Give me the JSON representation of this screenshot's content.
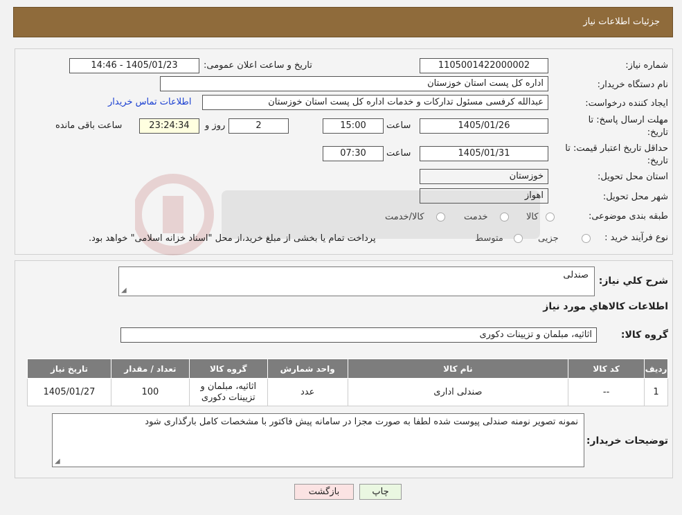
{
  "header": {
    "title": "جزئیات اطلاعات نیاز"
  },
  "form": {
    "need_number_label": "شماره نیاز:",
    "need_number": "1105001422000002",
    "announce_label": "تاریخ و ساعت اعلان عمومی:",
    "announce_value": "1405/01/23 - 14:46",
    "buyer_org_label": "نام دستگاه خریدار:",
    "buyer_org": "اداره کل پست استان خوزستان",
    "creator_label": "ایجاد کننده درخواست:",
    "creator": "عبدالله کرفسی مسئول تدارکات و خدمات اداره کل پست استان خوزستان",
    "contact_link": "اطلاعات تماس خریدار",
    "deadline_label_1": "مهلت ارسال پاسخ: تا",
    "deadline_label_2": "تاریخ:",
    "deadline_date": "1405/01/26",
    "time_label": "ساعت",
    "deadline_time": "15:00",
    "days_value": "2",
    "days_label": "روز و",
    "remaining_value": "23:24:34",
    "remaining_label": "ساعت باقی مانده",
    "validity_label_1": "حداقل تاریخ اعتبار قیمت: تا",
    "validity_label_2": "تاریخ:",
    "validity_date": "1405/01/31",
    "validity_time": "07:30",
    "province_label": "استان محل تحویل:",
    "province": "خوزستان",
    "city_label": "شهر محل تحویل:",
    "city": "اهواز",
    "category_label": "طبقه بندی موضوعی:",
    "category_options": [
      "کالا",
      "خدمت",
      "کالا/خدمت"
    ],
    "process_label": "نوع فرآیند خرید :",
    "process_options": [
      "جزیی",
      "متوسط"
    ],
    "process_note": "پرداخت تمام یا بخشی از مبلغ خرید،از محل \"اسناد خزانه اسلامی\" خواهد بود."
  },
  "details": {
    "summary_label": "شرح کلي نياز:",
    "summary": "صندلی",
    "goods_heading": "اطلاعات کالاهاي مورد نياز",
    "goods_group_label": "گروه کالا:",
    "goods_group": "اثاثیه، مبلمان و تزیینات دکوری",
    "table_headers": [
      "ردیف",
      "کد کالا",
      "نام کالا",
      "واحد شمارش",
      "گروه کالا",
      "تعداد / مقدار",
      "تاریخ نیاز"
    ],
    "rows": [
      {
        "index": "1",
        "code": "--",
        "name": "صندلی اداری",
        "unit": "عدد",
        "group_line1": "اثاثیه، مبلمان و",
        "group_line2": "تزیینات دکوری",
        "qty": "100",
        "date": "1405/01/27"
      }
    ],
    "buyer_notes_label": "توضیحات خریدار:",
    "buyer_notes": "نمونه تصویر نومنه صندلی پیوست شده لطفا به صورت مجزا در سامانه پیش فاکتور با مشخصات کامل بارگذاری شود"
  },
  "buttons": {
    "print": "چاپ",
    "back": "بازگشت"
  },
  "colors": {
    "header": "#8f6b3b",
    "table_header": "#7d7d7d",
    "back_button": "#fbe3e3",
    "print_button": "#eaf7e1",
    "link": "#1a3fd1"
  }
}
